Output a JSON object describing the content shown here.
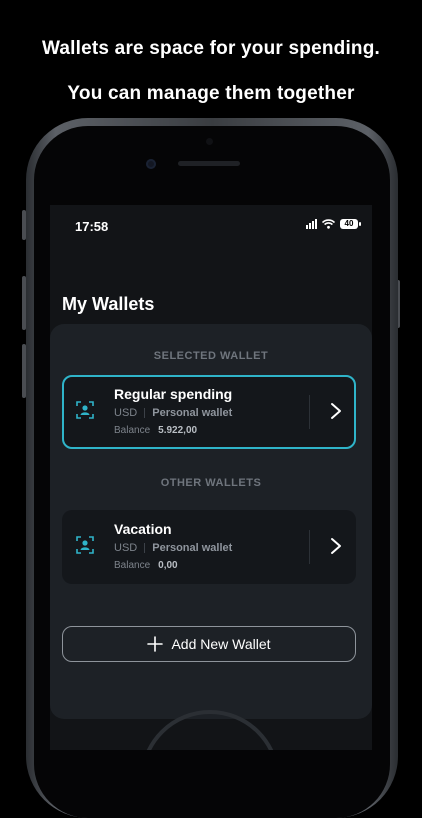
{
  "promo": {
    "line1": "Wallets are space for your spending.",
    "line2": "You can manage them together"
  },
  "status_bar": {
    "time": "17:58",
    "battery": "40",
    "icons": [
      "signal-icon",
      "wifi-icon",
      "battery-icon"
    ]
  },
  "page": {
    "title": "My Wallets"
  },
  "sections": {
    "selected_label": "SELECTED WALLET",
    "other_label": "OTHER WALLETS"
  },
  "selected_wallet": {
    "name": "Regular spending",
    "currency": "USD",
    "type": "Personal wallet",
    "balance_label": "Balance",
    "balance": "5.922,00",
    "icon": "person-scan-icon"
  },
  "other_wallets": [
    {
      "name": "Vacation",
      "currency": "USD",
      "type": "Personal wallet",
      "balance_label": "Balance",
      "balance": "0,00",
      "icon": "person-scan-icon"
    }
  ],
  "add_wallet": {
    "label": "Add New Wallet",
    "icon": "plus-icon"
  },
  "colors": {
    "accent": "#2fb4c9",
    "background": "#000000",
    "screen": "#121417",
    "sheet": "#1d2126",
    "card": "#14171b"
  }
}
